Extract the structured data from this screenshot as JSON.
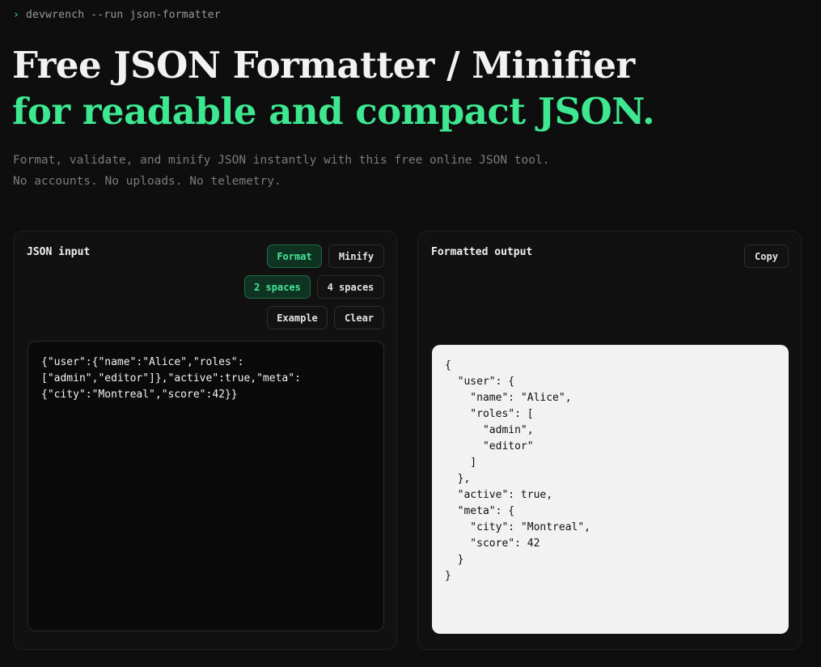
{
  "prompt": {
    "caret": "›",
    "command": "devwrench --run json-formatter"
  },
  "hero": {
    "title": "Free JSON Formatter / Minifier",
    "subtitle": "for readable and compact JSON.",
    "description": "Format, validate, and minify JSON instantly with this free online JSON tool. No accounts. No uploads. No telemetry."
  },
  "input_panel": {
    "title": "JSON input",
    "format_label": "Format",
    "minify_label": "Minify",
    "two_spaces_label": "2 spaces",
    "four_spaces_label": "4 spaces",
    "example_label": "Example",
    "clear_label": "Clear",
    "value": "{\"user\":{\"name\":\"Alice\",\"roles\":\n[\"admin\",\"editor\"]},\"active\":true,\"meta\":\n{\"city\":\"Montreal\",\"score\":42}}"
  },
  "output_panel": {
    "title": "Formatted output",
    "copy_label": "Copy",
    "value": "{\n  \"user\": {\n    \"name\": \"Alice\",\n    \"roles\": [\n      \"admin\",\n      \"editor\"\n    ]\n  },\n  \"active\": true,\n  \"meta\": {\n    \"city\": \"Montreal\",\n    \"score\": 42\n  }\n}"
  },
  "colors": {
    "accent": "#3ee891",
    "background": "#0e0e0e",
    "output_background": "#f2f2f2"
  }
}
